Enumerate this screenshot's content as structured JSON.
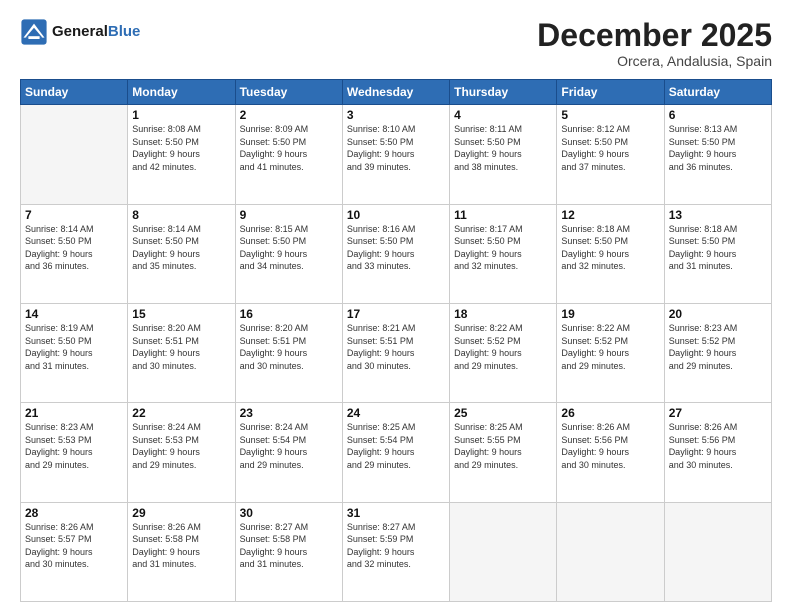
{
  "header": {
    "logo_line1": "General",
    "logo_line2": "Blue",
    "month": "December 2025",
    "location": "Orcera, Andalusia, Spain"
  },
  "weekdays": [
    "Sunday",
    "Monday",
    "Tuesday",
    "Wednesday",
    "Thursday",
    "Friday",
    "Saturday"
  ],
  "weeks": [
    [
      {
        "day": "",
        "detail": ""
      },
      {
        "day": "1",
        "detail": "Sunrise: 8:08 AM\nSunset: 5:50 PM\nDaylight: 9 hours\nand 42 minutes."
      },
      {
        "day": "2",
        "detail": "Sunrise: 8:09 AM\nSunset: 5:50 PM\nDaylight: 9 hours\nand 41 minutes."
      },
      {
        "day": "3",
        "detail": "Sunrise: 8:10 AM\nSunset: 5:50 PM\nDaylight: 9 hours\nand 39 minutes."
      },
      {
        "day": "4",
        "detail": "Sunrise: 8:11 AM\nSunset: 5:50 PM\nDaylight: 9 hours\nand 38 minutes."
      },
      {
        "day": "5",
        "detail": "Sunrise: 8:12 AM\nSunset: 5:50 PM\nDaylight: 9 hours\nand 37 minutes."
      },
      {
        "day": "6",
        "detail": "Sunrise: 8:13 AM\nSunset: 5:50 PM\nDaylight: 9 hours\nand 36 minutes."
      }
    ],
    [
      {
        "day": "7",
        "detail": "Sunrise: 8:14 AM\nSunset: 5:50 PM\nDaylight: 9 hours\nand 36 minutes."
      },
      {
        "day": "8",
        "detail": "Sunrise: 8:14 AM\nSunset: 5:50 PM\nDaylight: 9 hours\nand 35 minutes."
      },
      {
        "day": "9",
        "detail": "Sunrise: 8:15 AM\nSunset: 5:50 PM\nDaylight: 9 hours\nand 34 minutes."
      },
      {
        "day": "10",
        "detail": "Sunrise: 8:16 AM\nSunset: 5:50 PM\nDaylight: 9 hours\nand 33 minutes."
      },
      {
        "day": "11",
        "detail": "Sunrise: 8:17 AM\nSunset: 5:50 PM\nDaylight: 9 hours\nand 32 minutes."
      },
      {
        "day": "12",
        "detail": "Sunrise: 8:18 AM\nSunset: 5:50 PM\nDaylight: 9 hours\nand 32 minutes."
      },
      {
        "day": "13",
        "detail": "Sunrise: 8:18 AM\nSunset: 5:50 PM\nDaylight: 9 hours\nand 31 minutes."
      }
    ],
    [
      {
        "day": "14",
        "detail": "Sunrise: 8:19 AM\nSunset: 5:50 PM\nDaylight: 9 hours\nand 31 minutes."
      },
      {
        "day": "15",
        "detail": "Sunrise: 8:20 AM\nSunset: 5:51 PM\nDaylight: 9 hours\nand 30 minutes."
      },
      {
        "day": "16",
        "detail": "Sunrise: 8:20 AM\nSunset: 5:51 PM\nDaylight: 9 hours\nand 30 minutes."
      },
      {
        "day": "17",
        "detail": "Sunrise: 8:21 AM\nSunset: 5:51 PM\nDaylight: 9 hours\nand 30 minutes."
      },
      {
        "day": "18",
        "detail": "Sunrise: 8:22 AM\nSunset: 5:52 PM\nDaylight: 9 hours\nand 29 minutes."
      },
      {
        "day": "19",
        "detail": "Sunrise: 8:22 AM\nSunset: 5:52 PM\nDaylight: 9 hours\nand 29 minutes."
      },
      {
        "day": "20",
        "detail": "Sunrise: 8:23 AM\nSunset: 5:52 PM\nDaylight: 9 hours\nand 29 minutes."
      }
    ],
    [
      {
        "day": "21",
        "detail": "Sunrise: 8:23 AM\nSunset: 5:53 PM\nDaylight: 9 hours\nand 29 minutes."
      },
      {
        "day": "22",
        "detail": "Sunrise: 8:24 AM\nSunset: 5:53 PM\nDaylight: 9 hours\nand 29 minutes."
      },
      {
        "day": "23",
        "detail": "Sunrise: 8:24 AM\nSunset: 5:54 PM\nDaylight: 9 hours\nand 29 minutes."
      },
      {
        "day": "24",
        "detail": "Sunrise: 8:25 AM\nSunset: 5:54 PM\nDaylight: 9 hours\nand 29 minutes."
      },
      {
        "day": "25",
        "detail": "Sunrise: 8:25 AM\nSunset: 5:55 PM\nDaylight: 9 hours\nand 29 minutes."
      },
      {
        "day": "26",
        "detail": "Sunrise: 8:26 AM\nSunset: 5:56 PM\nDaylight: 9 hours\nand 30 minutes."
      },
      {
        "day": "27",
        "detail": "Sunrise: 8:26 AM\nSunset: 5:56 PM\nDaylight: 9 hours\nand 30 minutes."
      }
    ],
    [
      {
        "day": "28",
        "detail": "Sunrise: 8:26 AM\nSunset: 5:57 PM\nDaylight: 9 hours\nand 30 minutes."
      },
      {
        "day": "29",
        "detail": "Sunrise: 8:26 AM\nSunset: 5:58 PM\nDaylight: 9 hours\nand 31 minutes."
      },
      {
        "day": "30",
        "detail": "Sunrise: 8:27 AM\nSunset: 5:58 PM\nDaylight: 9 hours\nand 31 minutes."
      },
      {
        "day": "31",
        "detail": "Sunrise: 8:27 AM\nSunset: 5:59 PM\nDaylight: 9 hours\nand 32 minutes."
      },
      {
        "day": "",
        "detail": ""
      },
      {
        "day": "",
        "detail": ""
      },
      {
        "day": "",
        "detail": ""
      }
    ]
  ]
}
